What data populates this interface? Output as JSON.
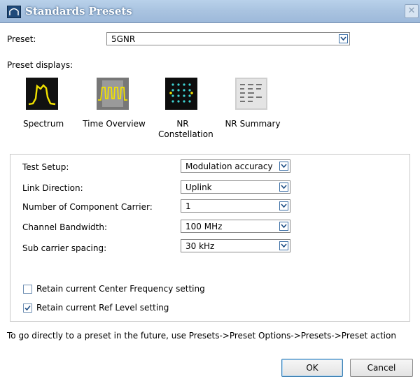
{
  "window": {
    "title": "Standards Presets"
  },
  "preset": {
    "label": "Preset:",
    "value": "5GNR"
  },
  "preset_displays": {
    "label": "Preset displays:",
    "items": [
      {
        "label": "Spectrum",
        "icon": "spectrum-icon"
      },
      {
        "label": "Time Overview",
        "icon": "time-overview-icon"
      },
      {
        "label": "NR Constellation",
        "icon": "nr-constellation-icon"
      },
      {
        "label": "NR Summary",
        "icon": "nr-summary-icon"
      }
    ]
  },
  "settings": [
    {
      "label": "Test Setup:",
      "value": "Modulation accuracy"
    },
    {
      "label": "Link Direction:",
      "value": "Uplink"
    },
    {
      "label": "Number of Component Carrier:",
      "value": "1"
    },
    {
      "label": "Channel Bandwidth:",
      "value": "100 MHz"
    },
    {
      "label": "Sub carrier spacing:",
      "value": "30 kHz"
    }
  ],
  "checkboxes": [
    {
      "label": "Retain current Center Frequency setting",
      "checked": false
    },
    {
      "label": "Retain current Ref Level setting",
      "checked": true
    }
  ],
  "hint": "To go directly to a preset in the future, use Presets->Preset Options->Presets->Preset action",
  "buttons": {
    "ok": "OK",
    "cancel": "Cancel"
  },
  "colors": {
    "title_bar": "#a9c3e0",
    "trace_yellow": "#f2e200",
    "constellation_cyan": "#3fd4d4"
  }
}
